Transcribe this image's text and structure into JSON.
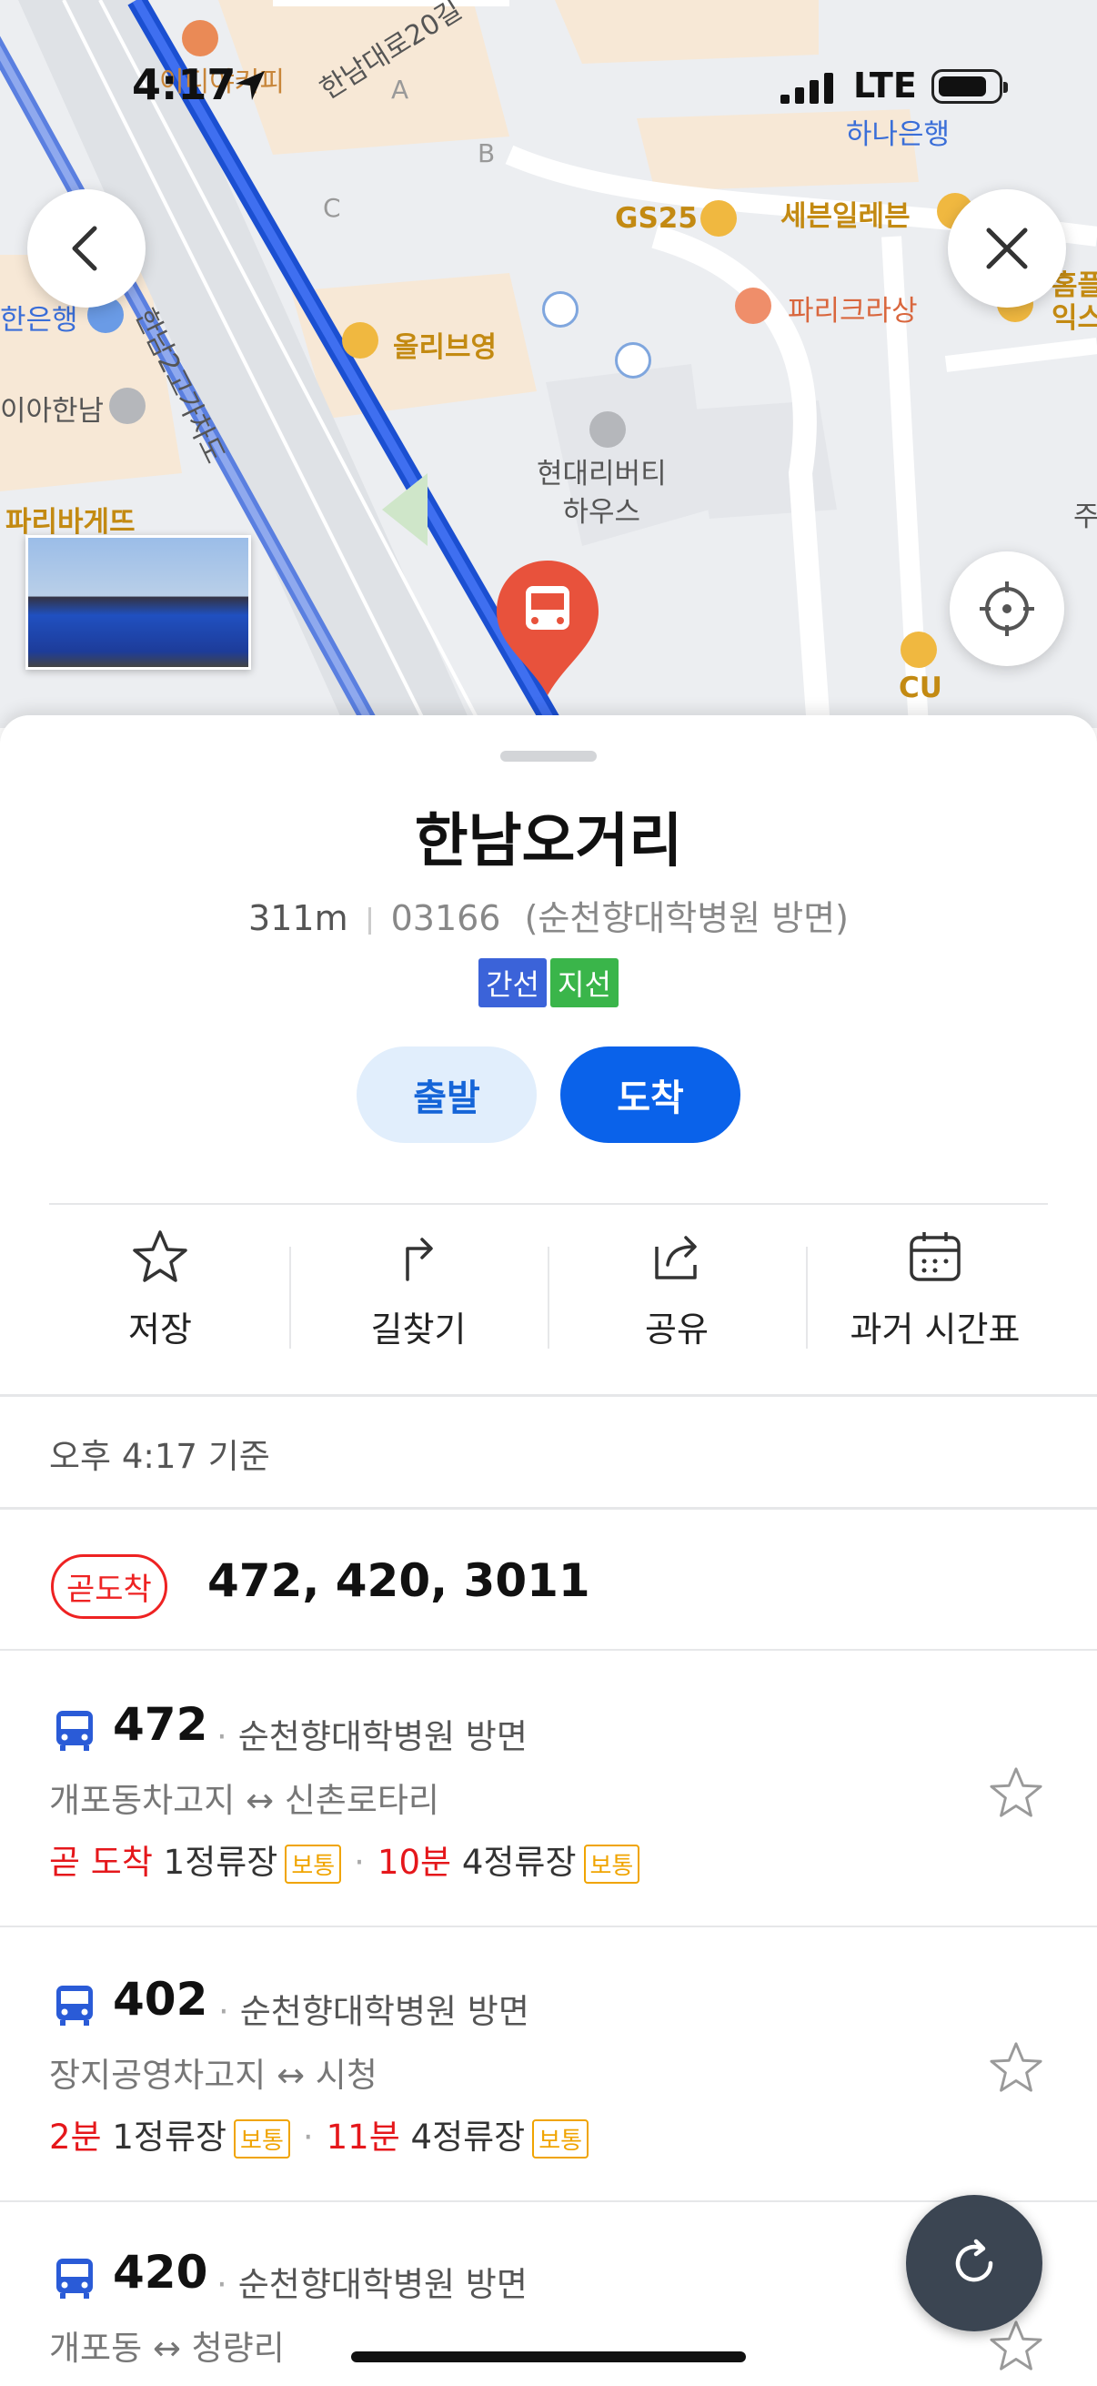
{
  "status_bar": {
    "time": "4:17",
    "network": "LTE"
  },
  "map": {
    "labels": {
      "road_top": "한남대로20길",
      "overpass": "한남2고가차도",
      "hana": "하나은행",
      "gs25": "GS25",
      "seven": "세븐일레븐",
      "paris_croissant": "파리크라상",
      "homeplus": "홈플\n익스",
      "olive": "올리브영",
      "hyundai": "현대리버티\n하우스",
      "bank_left": "한은행",
      "ia_hannam": "이아한남",
      "paris_baguette": "파리바게뜨",
      "cu": "CU",
      "cafe": "이디야커피",
      "a": "A",
      "b": "B",
      "c": "C",
      "ju": "주"
    }
  },
  "stop": {
    "name": "한남오거리",
    "distance": "311m",
    "stop_id": "03166",
    "direction": "(순천향대학병원 방면)",
    "tags": [
      {
        "label": "간선",
        "color": "#3b63d9"
      },
      {
        "label": "지선",
        "color": "#3ab54a"
      }
    ]
  },
  "buttons": {
    "departure": "출발",
    "arrival": "도착"
  },
  "actions": [
    {
      "label": "저장",
      "icon": "star-outline-icon"
    },
    {
      "label": "길찾기",
      "icon": "route-turn-icon"
    },
    {
      "label": "공유",
      "icon": "share-icon"
    },
    {
      "label": "과거 시간표",
      "icon": "calendar-icon"
    }
  ],
  "basis_time": "오후 4:17 기준",
  "arriving_soon": {
    "badge": "곧도착",
    "buses": "472, 420, 3011"
  },
  "buses": [
    {
      "number": "472",
      "direction": "순천향대학병원 방면",
      "route": "개포동차고지 ↔ 신촌로타리",
      "first_time": "곧 도착",
      "first_stops": "1정류장",
      "first_crowd": "보통",
      "second_time": "10분",
      "second_stops": "4정류장",
      "second_crowd": "보통"
    },
    {
      "number": "402",
      "direction": "순천향대학병원 방면",
      "route": "장지공영차고지 ↔ 시청",
      "first_time": "2분",
      "first_stops": "1정류장",
      "first_crowd": "보통",
      "second_time": "11분",
      "second_stops": "4정류장",
      "second_crowd": "보통"
    },
    {
      "number": "420",
      "direction": "순천향대학병원 방면",
      "route": "개포동 ↔ 청량리"
    }
  ],
  "colors": {
    "accent": "#0a62ea",
    "alert": "#e5171b",
    "crowd": "#f0a400",
    "bus_blue": "#2a5bd7"
  }
}
